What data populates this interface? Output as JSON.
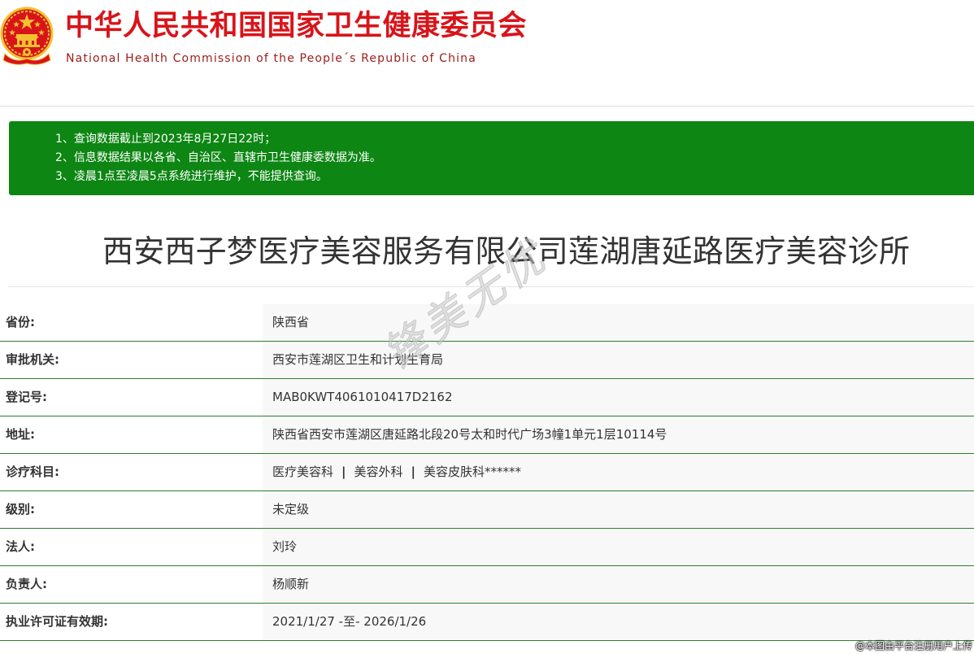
{
  "header": {
    "title_cn": "中华人民共和国国家卫生健康委员会",
    "title_en": "National Health Commission of the People´s Republic of China",
    "emblem_icon": "national-emblem-icon",
    "colors": {
      "title": "#d8141a",
      "emblem_red": "#d8141a",
      "emblem_gold": "#f2c230"
    }
  },
  "notice": {
    "background": "#0d8613",
    "lines": [
      "1、查询数据截止到2023年8月27日22时；",
      "2、信息数据结果以各省、自治区、直辖市卫生健康委数据为准。",
      "3、凌晨1点至凌晨5点系统进行维护，不能提供查询。"
    ]
  },
  "organization": {
    "name": "西安西子梦医疗美容服务有限公司莲湖唐延路医疗美容诊所"
  },
  "info": {
    "province": {
      "label": "省份:",
      "value": "陕西省"
    },
    "approval_authority": {
      "label": "审批机关:",
      "value": "西安市莲湖区卫生和计划生育局"
    },
    "registration_no": {
      "label": "登记号:",
      "value": "MAB0KWT4061010417D2162"
    },
    "address": {
      "label": "地址:",
      "value": "陕西省西安市莲湖区唐延路北段20号太和时代广场3幢1单元1层10114号"
    },
    "departments": {
      "label": "诊疗科目:",
      "items": [
        "医疗美容科",
        "美容外科",
        "美容皮肤科******"
      ],
      "separator": "|"
    },
    "level": {
      "label": "级别:",
      "value": "未定级"
    },
    "legal_person": {
      "label": "法人:",
      "value": "刘玲"
    },
    "responsible_person": {
      "label": "负责人:",
      "value": "杨顺新"
    },
    "license_validity": {
      "label": "执业许可证有效期:",
      "value": "2021/1/27 -至- 2026/1/26"
    },
    "row_border_color": "#2e7d32"
  },
  "watermarks": {
    "center": "锋美无忧",
    "corner": "@本图由平台注册用户上传"
  }
}
